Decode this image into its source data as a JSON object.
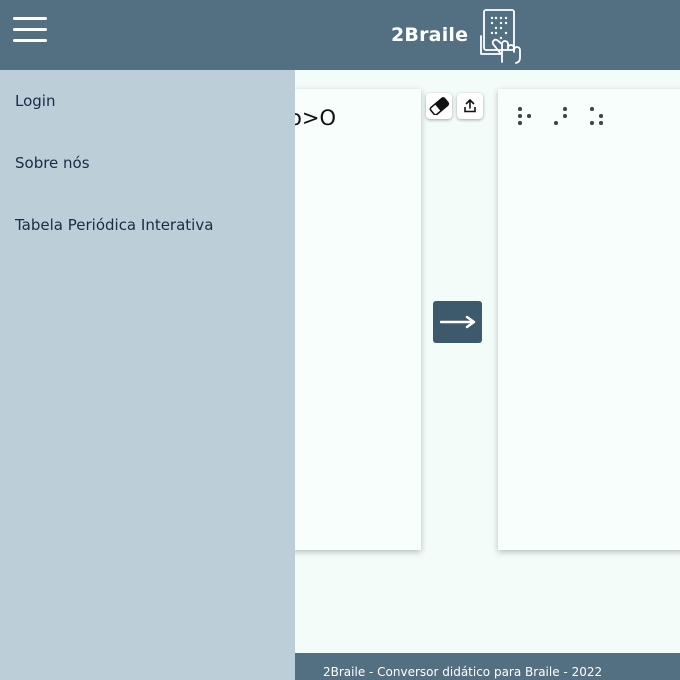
{
  "header": {
    "brand": "2Braile",
    "logo_icon": "braille-tablet-hand-icon",
    "menu_icon": "hamburger-menu-icon"
  },
  "sidebar": {
    "items": [
      {
        "label": "Login"
      },
      {
        "label": "Sobre nós"
      },
      {
        "label": "Tabela Periódica Interativa"
      }
    ]
  },
  "editor": {
    "input_text": "o>O",
    "eraser_icon": "eraser-icon",
    "share_icon": "share-upload-icon",
    "convert_icon": "arrow-right-icon"
  },
  "output": {
    "braille_cells": [
      {
        "dots": [
          1,
          2,
          3,
          5
        ]
      },
      {
        "dots": [
          3,
          4,
          5
        ]
      },
      {
        "dots": [
          1,
          3,
          5,
          6
        ]
      }
    ]
  },
  "footer": {
    "text": "2Braile - Conversor didático para Braile - 2022"
  },
  "colors": {
    "header_bg": "#537083",
    "sidebar_bg": "#bccfd8",
    "page_bg": "#f4fcfa",
    "convert_btn_bg": "#3d5a6c"
  }
}
